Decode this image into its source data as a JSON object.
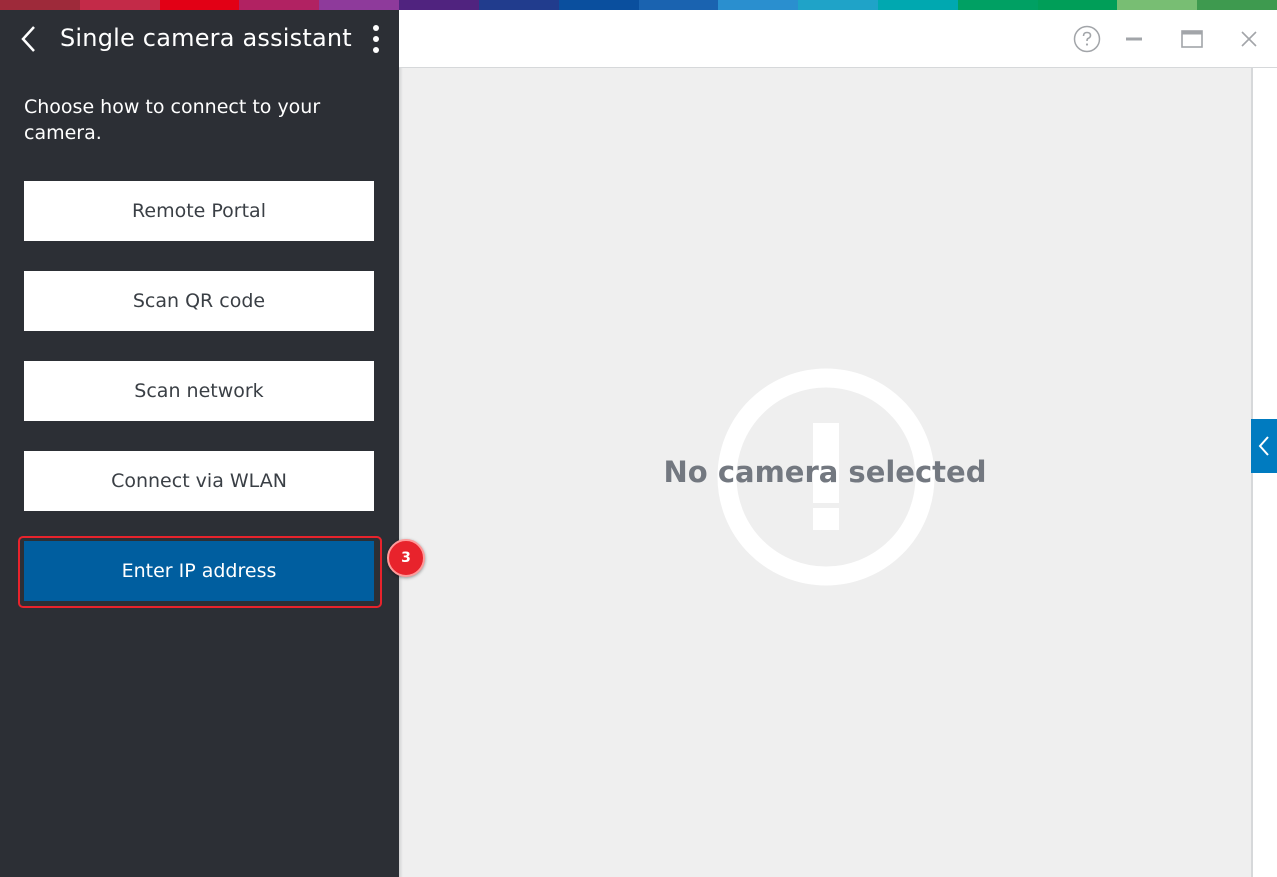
{
  "supergraphic_colors": [
    "#9e2a3a",
    "#c32a48",
    "#e20015",
    "#b12262",
    "#8e3a9b",
    "#50237f",
    "#213c8d",
    "#0a4f9e",
    "#1a63b0",
    "#2a8fcf",
    "#1fa3c8",
    "#00a8b0",
    "#00a063",
    "#009e58",
    "#78be73",
    "#3e9a4f"
  ],
  "sidebar": {
    "title": "Single camera assistant",
    "prompt": "Choose how to connect to your camera.",
    "options": [
      {
        "label": "Remote Portal"
      },
      {
        "label": "Scan QR code"
      },
      {
        "label": "Scan network"
      },
      {
        "label": "Connect via WLAN"
      },
      {
        "label": "Enter IP address"
      }
    ],
    "step_badge": "3"
  },
  "main": {
    "empty_message": "No camera selected",
    "icons": {
      "help": "help-circle-icon",
      "minimize": "minimize-icon",
      "maximize": "maximize-icon",
      "close": "close-icon",
      "expand": "chevron-left-icon",
      "empty": "alert-circle-icon"
    }
  },
  "colors": {
    "sidebar_bg": "#2c2f35",
    "primary_button": "#005e9f",
    "highlight": "#e8232c",
    "accent": "#007bc0"
  }
}
